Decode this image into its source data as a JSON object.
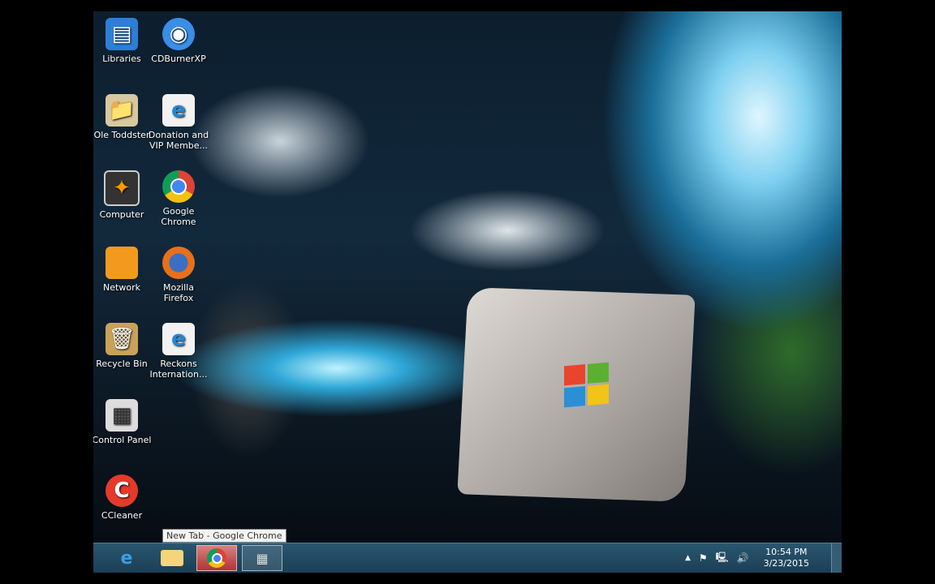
{
  "desktop": {
    "icons": [
      {
        "label": "Libraries",
        "icon": "libraries-icon"
      },
      {
        "label": "CDBurnerXP",
        "icon": "cdburner-icon"
      },
      {
        "label": "Ole Toddster",
        "icon": "user-folder-icon"
      },
      {
        "label": "Donation and VIP Membe...",
        "icon": "ie-shortcut-icon"
      },
      {
        "label": "Computer",
        "icon": "computer-icon"
      },
      {
        "label": "Google Chrome",
        "icon": "chrome-icon"
      },
      {
        "label": "Network",
        "icon": "network-icon"
      },
      {
        "label": "Mozilla Firefox",
        "icon": "firefox-icon"
      },
      {
        "label": "Recycle Bin",
        "icon": "recycle-bin-icon"
      },
      {
        "label": "Reckons Internation...",
        "icon": "ie-shortcut-icon"
      },
      {
        "label": "Control Panel",
        "icon": "control-panel-icon"
      },
      {
        "label": "CCleaner",
        "icon": "ccleaner-icon"
      }
    ]
  },
  "tooltip": "New Tab - Google Chrome",
  "tray": {
    "time": "10:54 PM",
    "date": "3/23/2015"
  }
}
